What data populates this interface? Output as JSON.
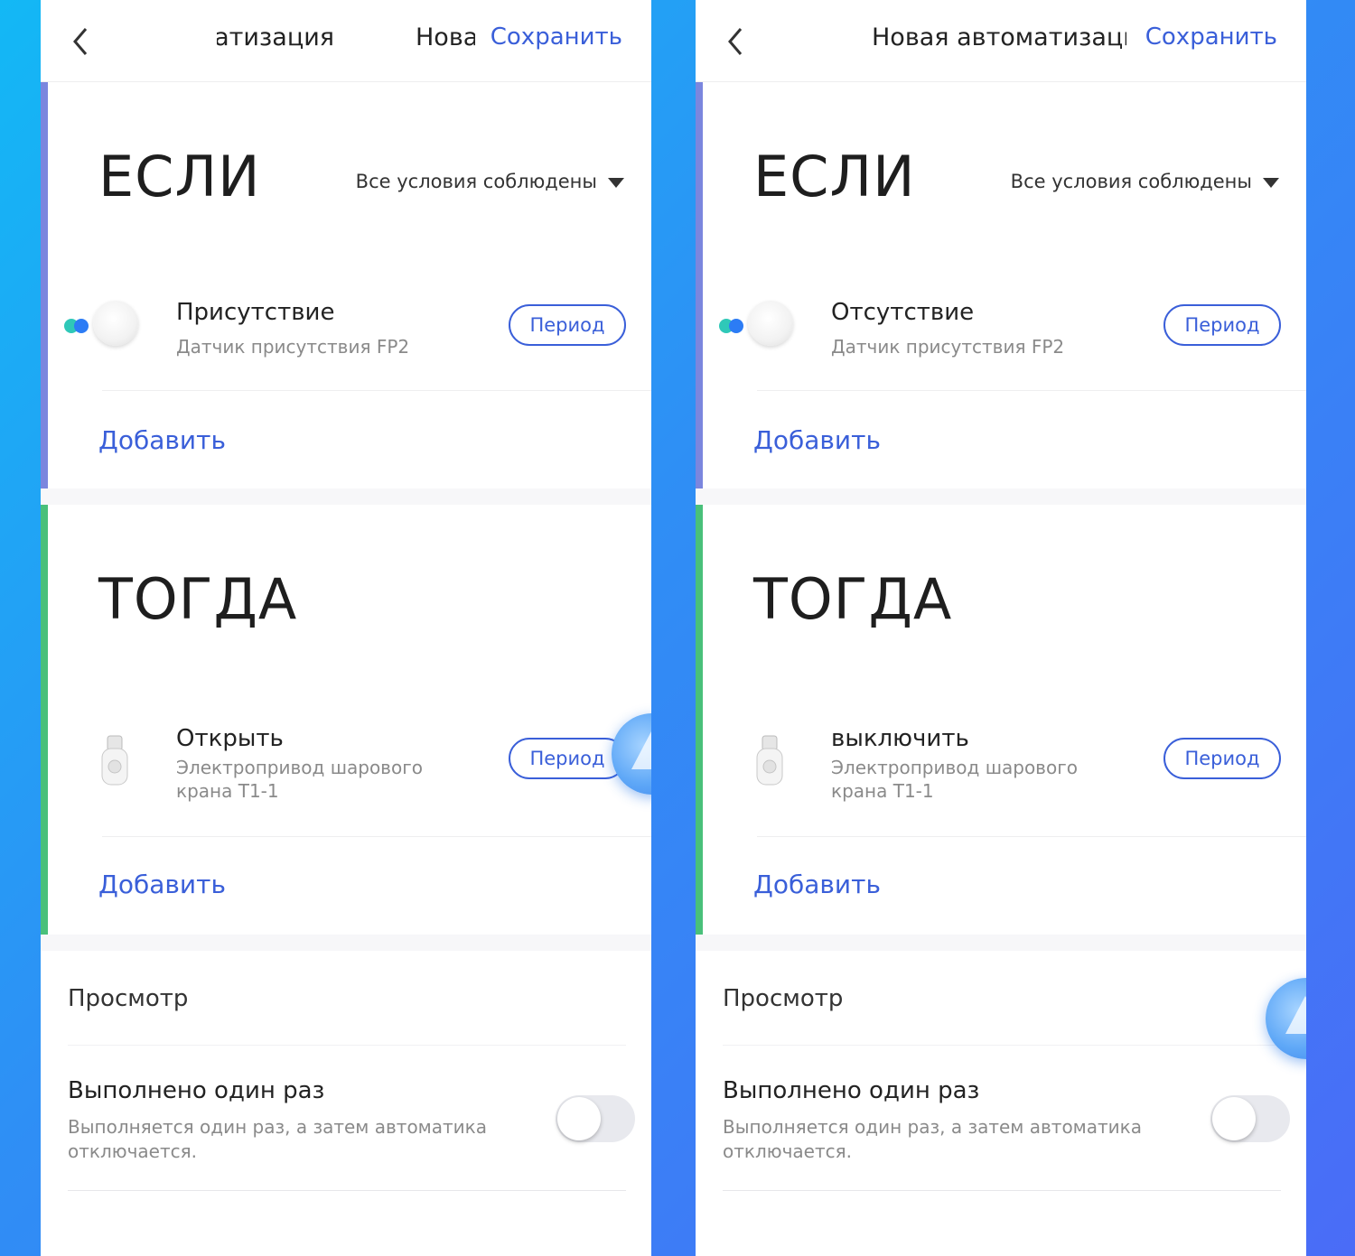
{
  "left_panel": {
    "header": {
      "title_part1": "атизация",
      "title_part2": "Нова",
      "save_label": "Сохранить"
    },
    "if": {
      "heading": "ЕСЛИ",
      "mode": "Все условия соблюдены",
      "item": {
        "title": "Присутствие",
        "subtitle": "Датчик присутствия FP2",
        "period_label": "Период"
      },
      "add_label": "Добавить"
    },
    "then": {
      "heading": "ТОГДА",
      "item": {
        "title": "Открыть",
        "subtitle": "Электропривод шарового крана T1-1",
        "period_label": "Период"
      },
      "add_label": "Добавить"
    },
    "preview": {
      "label": "Просмотр",
      "once_title": "Выполнено один раз",
      "once_desc": "Выполняется один раз, а затем автоматика отключается.",
      "toggle_on": false
    }
  },
  "right_panel": {
    "header": {
      "title": "Новая автоматизаци",
      "save_label": "Сохранить"
    },
    "if": {
      "heading": "ЕСЛИ",
      "mode": "Все условия соблюдены",
      "item": {
        "title": "Отсутствие",
        "subtitle": "Датчик присутствия FP2",
        "period_label": "Период"
      },
      "add_label": "Добавить"
    },
    "then": {
      "heading": "ТОГДА",
      "item": {
        "title": "выключить",
        "subtitle": "Электропривод шарового крана T1-1",
        "period_label": "Период"
      },
      "add_label": "Добавить"
    },
    "preview": {
      "label": "Просмотр",
      "once_title": "Выполнено один раз",
      "once_desc": "Выполняется один раз, а затем автоматика отключается.",
      "toggle_on": false
    }
  },
  "colors": {
    "accent": "#3a5fd9",
    "if_bar": "#7b86de",
    "then_bar": "#49c07a",
    "background_gradient": [
      "#13b8f5",
      "#4a6cf7"
    ]
  },
  "icons": [
    "back-chevron-icon",
    "dropdown-caret-icon",
    "presence-sensor-icon",
    "ball-valve-icon",
    "floating-assistant-icon"
  ]
}
